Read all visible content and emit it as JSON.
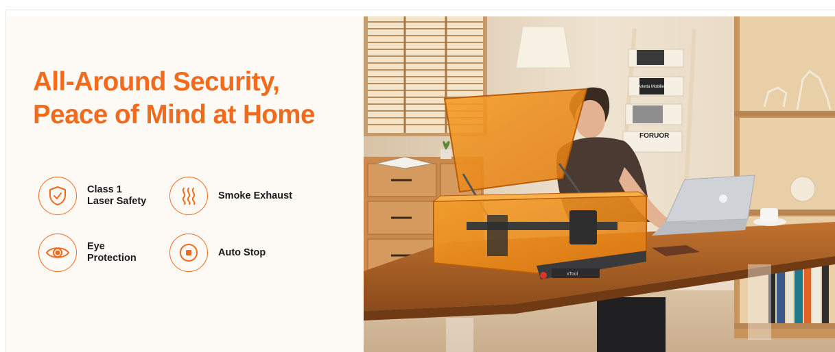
{
  "headline": {
    "line1": "All-Around Security,",
    "line2": "Peace of Mind at Home"
  },
  "features": [
    {
      "line1": "Class 1",
      "line2": "Laser Safety",
      "icon": "shield-check-icon"
    },
    {
      "line1": "Smoke Exhaust",
      "line2": "",
      "icon": "smoke-waves-icon"
    },
    {
      "line1": "Eye",
      "line2": "Protection",
      "icon": "eye-icon"
    },
    {
      "line1": "Auto Stop",
      "line2": "",
      "icon": "stop-button-icon"
    }
  ],
  "photo": {
    "shelf_book_label": "FORUOR",
    "magazine_label": "Arletta Mobilier",
    "machine_badge": "xTool"
  },
  "colors": {
    "accent": "#f26b1d",
    "panel_bg": "#fdf9f5",
    "text": "#1a1a1a"
  }
}
